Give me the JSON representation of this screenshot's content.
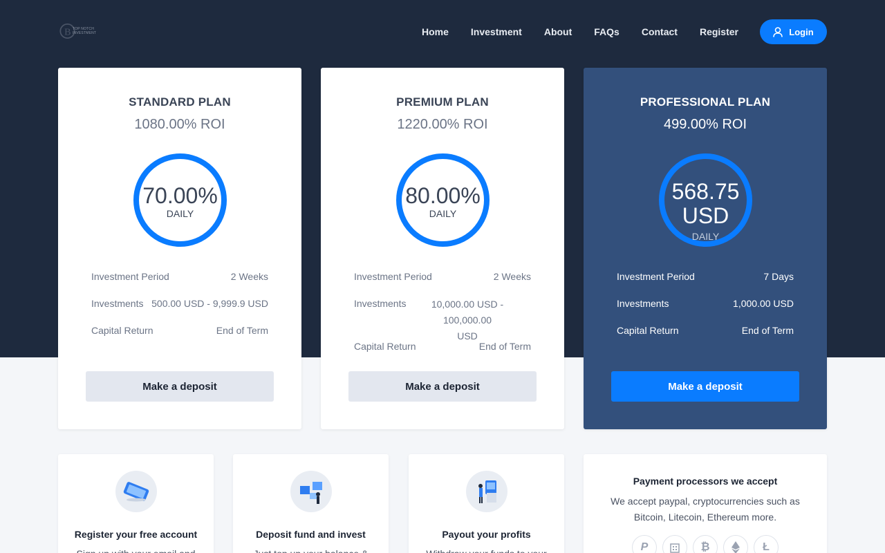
{
  "brand": {
    "logo_text": "TOP NOTCH INVESTMENT"
  },
  "nav": {
    "links": [
      "Home",
      "Investment",
      "About",
      "FAQs",
      "Contact",
      "Register"
    ],
    "login_label": "Login"
  },
  "plans": [
    {
      "title": "STANDARD PLAN",
      "roi": "1080.00% ROI",
      "ring_value": "70.00%",
      "ring_label": "DAILY",
      "details": [
        {
          "key": "Investment Period",
          "value": "2 Weeks"
        },
        {
          "key": "Investments",
          "value": "500.00 USD - 9,999.9 USD"
        },
        {
          "key": "Capital Return",
          "value": "End of Term"
        }
      ],
      "button": "Make a deposit"
    },
    {
      "title": "PREMIUM PLAN",
      "roi": "1220.00% ROI",
      "ring_value": "80.00%",
      "ring_label": "DAILY",
      "details": [
        {
          "key": "Investment Period",
          "value": "2 Weeks"
        },
        {
          "key": "Investments",
          "value_line1": "10,000.00 USD - 100,000.00",
          "value_line2": "USD"
        },
        {
          "key": "Capital Return",
          "value": "End of Term"
        }
      ],
      "button": "Make a deposit"
    },
    {
      "title": "PROFESSIONAL PLAN",
      "roi": "499.00% ROI",
      "ring_value_line1": "568.75",
      "ring_value_line2": "USD",
      "ring_label": "DAILY",
      "details": [
        {
          "key": "Investment Period",
          "value": "7 Days"
        },
        {
          "key": "Investments",
          "value": "1,000.00 USD"
        },
        {
          "key": "Capital Return",
          "value": "End of Term"
        }
      ],
      "button": "Make a deposit"
    }
  ],
  "steps": [
    {
      "title": "Register your free account",
      "text": "Sign up with your email and",
      "icon": "phone-icon"
    },
    {
      "title": "Deposit fund and invest",
      "text": "Just top up your balance &",
      "icon": "invest-icon"
    },
    {
      "title": "Payout your profits",
      "text": "Withdraw your funds to your",
      "icon": "payout-icon"
    }
  ],
  "payments": {
    "title": "Payment processors we accept",
    "text": "We accept paypal, cryptocurrencies such as Bitcoin, Litecoin, Ethereum more.",
    "icons": [
      "paypal-icon",
      "bank-icon",
      "bitcoin-icon",
      "ethereum-icon",
      "litecoin-icon"
    ]
  },
  "colors": {
    "hero": "#1e2a3e",
    "accent": "#0a7cff",
    "featured": "#33507c"
  }
}
